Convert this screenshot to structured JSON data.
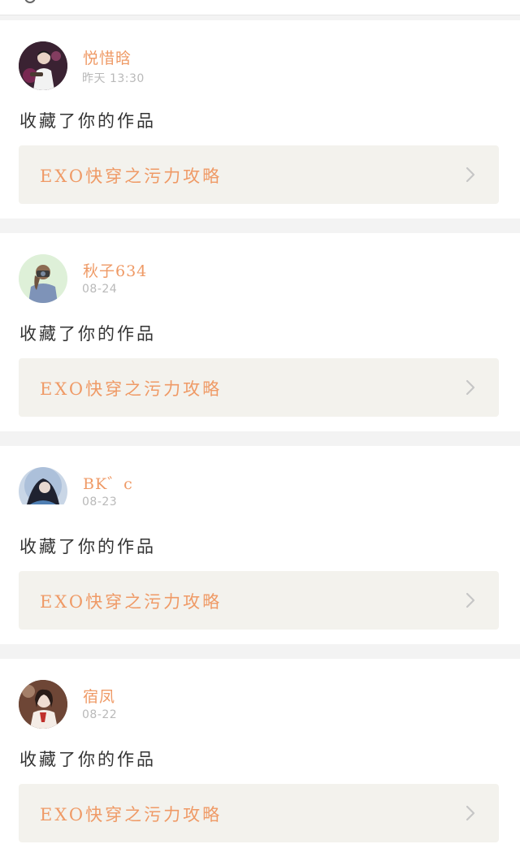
{
  "feed": {
    "items": [
      {
        "username": "悦惜晗",
        "timestamp": "昨天 13:30",
        "action": "收藏了你的作品",
        "work_title": "EXO快穿之污力攻略"
      },
      {
        "username": "秋子634",
        "timestamp": "08-24",
        "action": "收藏了你的作品",
        "work_title": "EXO快穿之污力攻略"
      },
      {
        "username": "BK゛c",
        "timestamp": "08-23",
        "action": "收藏了你的作品",
        "work_title": "EXO快穿之污力攻略"
      },
      {
        "username": "宿凤",
        "timestamp": "08-22",
        "action": "收藏了你的作品",
        "work_title": "EXO快穿之污力攻略"
      }
    ]
  },
  "colors": {
    "accent": "#ef9a66",
    "link_bg": "#f3f2ed",
    "page_bg": "#f3f3f3",
    "timestamp": "#b9b9b9",
    "text": "#333333"
  },
  "icons": {
    "chevron": "chevron-right-icon",
    "avatar": "avatar"
  }
}
